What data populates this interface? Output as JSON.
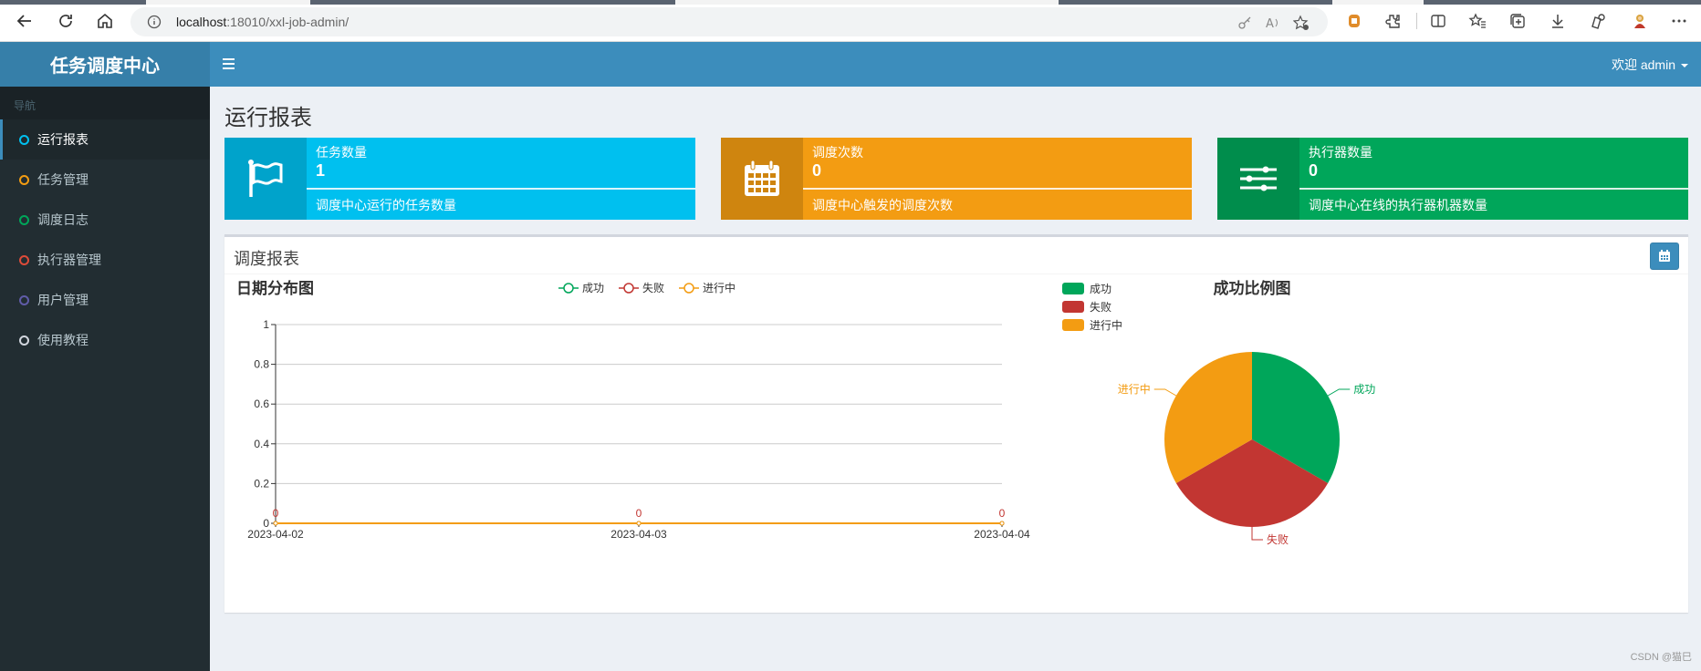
{
  "browser": {
    "url_host": "localhost",
    "url_rest": ":18010/xxl-job-admin/"
  },
  "app": {
    "logo": "任务调度中心",
    "user_label": "欢迎 admin"
  },
  "sidebar": {
    "header": "导航",
    "items": [
      {
        "label": "运行报表",
        "color": "#00c0ef",
        "active": true
      },
      {
        "label": "任务管理",
        "color": "#f39c12",
        "active": false
      },
      {
        "label": "调度日志",
        "color": "#00a65a",
        "active": false
      },
      {
        "label": "执行器管理",
        "color": "#dd4b39",
        "active": false
      },
      {
        "label": "用户管理",
        "color": "#605ca8",
        "active": false
      },
      {
        "label": "使用教程",
        "color": "#d2d6de",
        "active": false
      }
    ]
  },
  "page": {
    "title": "运行报表"
  },
  "info_boxes": [
    {
      "title": "任务数量",
      "number": "1",
      "desc": "调度中心运行的任务数量",
      "icon": "flag-icon",
      "color": "#00c0ef"
    },
    {
      "title": "调度次数",
      "number": "0",
      "desc": "调度中心触发的调度次数",
      "icon": "calendar-icon",
      "color": "#f39c12"
    },
    {
      "title": "执行器数量",
      "number": "0",
      "desc": "调度中心在线的执行器机器数量",
      "icon": "sliders-icon",
      "color": "#00a65a"
    }
  ],
  "report": {
    "title": "调度报表"
  },
  "chart_data": [
    {
      "type": "line",
      "title": "日期分布图",
      "x": [
        "2023-04-02",
        "2023-04-03",
        "2023-04-04"
      ],
      "ylim": [
        0,
        1
      ],
      "yticks": [
        "0",
        "0.2",
        "0.4",
        "0.6",
        "0.8",
        "1"
      ],
      "grid": true,
      "legend_position": "top",
      "series": [
        {
          "name": "成功",
          "values": [
            0,
            0,
            0
          ],
          "color": "#00a65a"
        },
        {
          "name": "失败",
          "values": [
            0,
            0,
            0
          ],
          "color": "#c23632"
        },
        {
          "name": "进行中",
          "values": [
            0,
            0,
            0
          ],
          "color": "#f39c12"
        }
      ],
      "data_labels": [
        "0",
        "0",
        "0"
      ]
    },
    {
      "type": "pie",
      "title": "成功比例图",
      "legend_position": "top-left",
      "slices": [
        {
          "name": "成功",
          "value": 1,
          "color": "#00a65a"
        },
        {
          "name": "失败",
          "value": 1,
          "color": "#c23632"
        },
        {
          "name": "进行中",
          "value": 1,
          "color": "#f39c12"
        }
      ]
    }
  ],
  "watermark": "CSDN @猫巳"
}
